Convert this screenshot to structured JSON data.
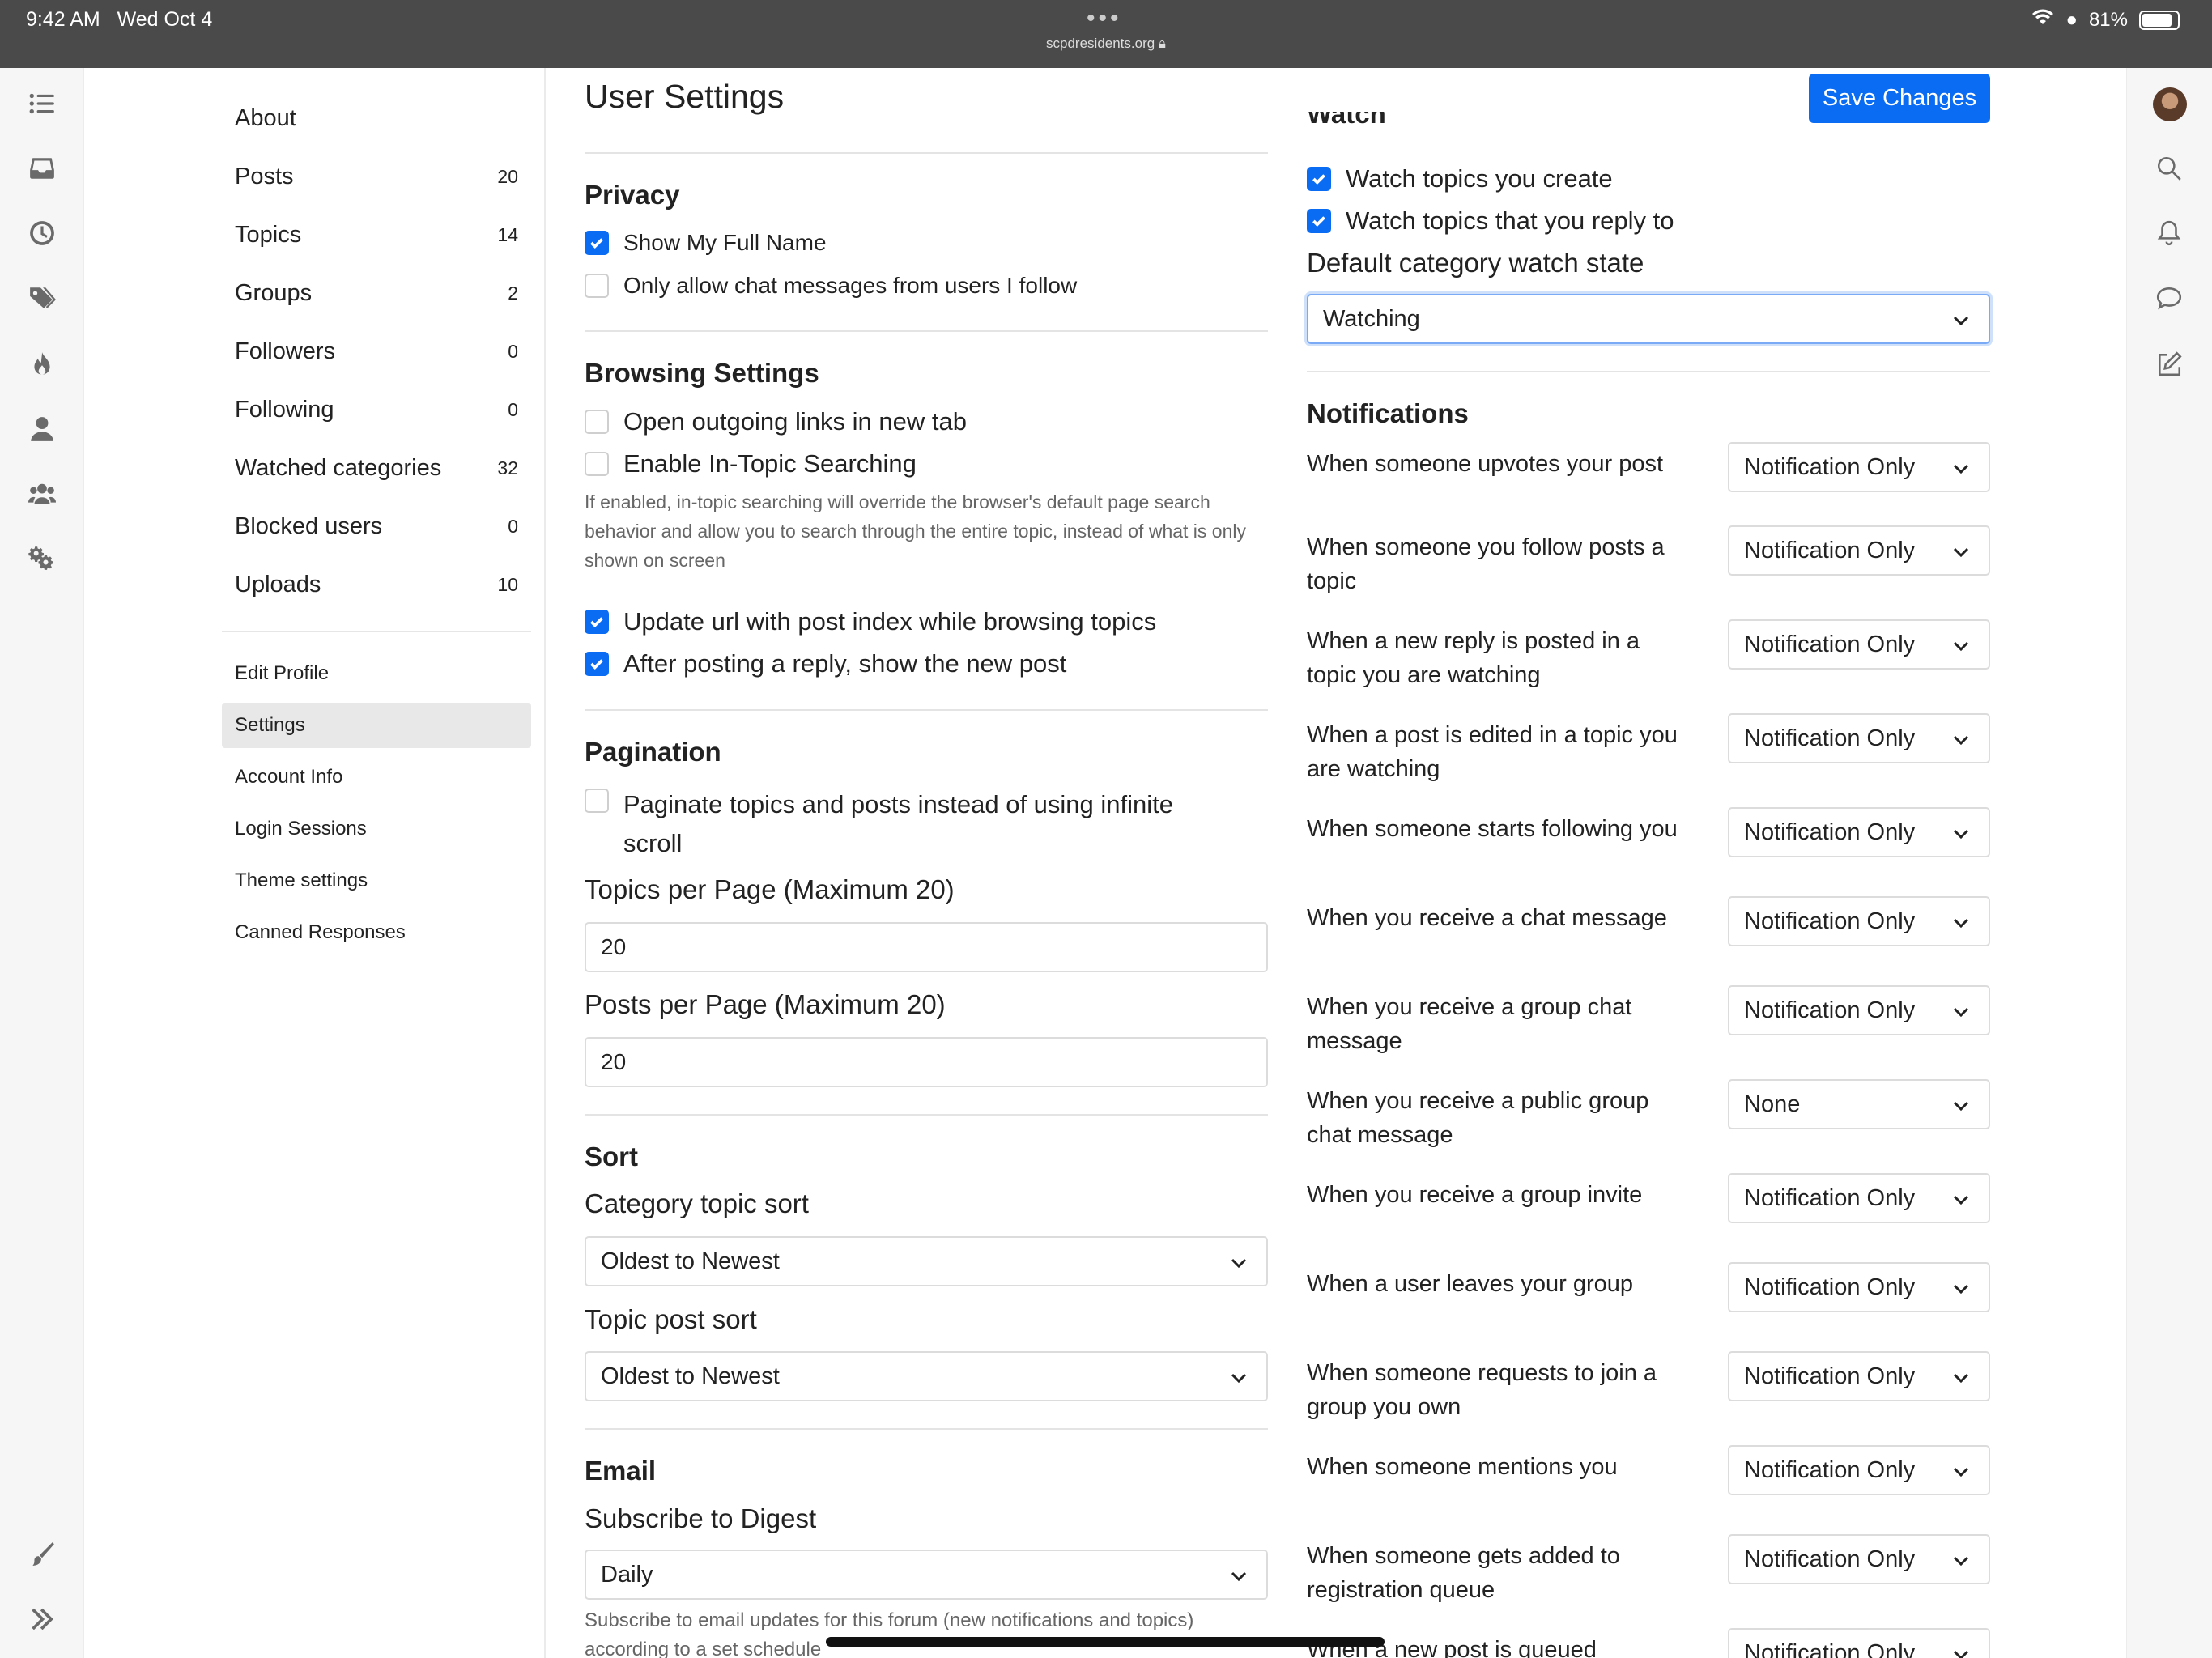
{
  "status": {
    "time": "9:42 AM",
    "date": "Wed Oct 4",
    "url": "scpdresidents.org",
    "battery": "81%"
  },
  "nav": {
    "items": [
      {
        "label": "About",
        "count": ""
      },
      {
        "label": "Posts",
        "count": "20"
      },
      {
        "label": "Topics",
        "count": "14"
      },
      {
        "label": "Groups",
        "count": "2"
      },
      {
        "label": "Followers",
        "count": "0"
      },
      {
        "label": "Following",
        "count": "0"
      },
      {
        "label": "Watched categories",
        "count": "32"
      },
      {
        "label": "Blocked users",
        "count": "0"
      },
      {
        "label": "Uploads",
        "count": "10"
      }
    ],
    "sub": [
      "Edit Profile",
      "Settings",
      "Account Info",
      "Login Sessions",
      "Theme settings",
      "Canned Responses"
    ],
    "active_sub": "Settings"
  },
  "page": {
    "title": "User Settings",
    "save_label": "Save Changes"
  },
  "privacy": {
    "title": "Privacy",
    "show_full_name": {
      "label": "Show My Full Name",
      "checked": true
    },
    "chat_follow_only": {
      "label": "Only allow chat messages from users I follow",
      "checked": false
    }
  },
  "browsing": {
    "title": "Browsing Settings",
    "open_links_new_tab": {
      "label": "Open outgoing links in new tab",
      "checked": false
    },
    "in_topic_search": {
      "label": "Enable In-Topic Searching",
      "checked": false
    },
    "help": "If enabled, in-topic searching will override the browser's default page search behavior and allow you to search through the entire topic, instead of what is only shown on screen",
    "update_url": {
      "label": "Update url with post index while browsing topics",
      "checked": true
    },
    "show_new_post": {
      "label": "After posting a reply, show the new post",
      "checked": true
    }
  },
  "pagination": {
    "title": "Pagination",
    "paginate": {
      "label_line1": "Paginate topics and posts instead of using infinite",
      "label_line2": "scroll",
      "checked": false
    },
    "topics_per_page_label": "Topics per Page (Maximum 20)",
    "topics_per_page": "20",
    "posts_per_page_label": "Posts per Page (Maximum 20)",
    "posts_per_page": "20"
  },
  "sort": {
    "title": "Sort",
    "category_label": "Category topic sort",
    "category_value": "Oldest to Newest",
    "topic_label": "Topic post sort",
    "topic_value": "Oldest to Newest"
  },
  "email": {
    "title": "Email",
    "digest_label": "Subscribe to Digest",
    "digest_value": "Daily",
    "help_line1": "Subscribe to email updates for this forum (new notifications and topics)",
    "help_line2": "according to a set schedule"
  },
  "watch": {
    "title": "Watch",
    "watch_create": {
      "label": "Watch topics you create",
      "checked": true
    },
    "watch_reply": {
      "label": "Watch topics that you reply to",
      "checked": true
    },
    "default_label": "Default category watch state",
    "default_value": "Watching"
  },
  "notifications": {
    "title": "Notifications",
    "rows": [
      {
        "l1": "When someone upvotes your post",
        "l2": "",
        "value": "Notification Only"
      },
      {
        "l1": "When someone you follow posts a",
        "l2": "topic",
        "value": "Notification Only"
      },
      {
        "l1": "When a new reply is posted in a",
        "l2": "topic you are watching",
        "value": "Notification Only"
      },
      {
        "l1": "When a post is edited in a topic you",
        "l2": "are watching",
        "value": "Notification Only"
      },
      {
        "l1": "When someone starts following you",
        "l2": "",
        "value": "Notification Only"
      },
      {
        "l1": "When you receive a chat message",
        "l2": "",
        "value": "Notification Only"
      },
      {
        "l1": "When you receive a group chat",
        "l2": "message",
        "value": "Notification Only"
      },
      {
        "l1": "When you receive a public group",
        "l2": "chat message",
        "value": "None"
      },
      {
        "l1": "When you receive a group invite",
        "l2": "",
        "value": "Notification Only"
      },
      {
        "l1": "When a user leaves your group",
        "l2": "",
        "value": "Notification Only"
      },
      {
        "l1": "When someone requests to join a",
        "l2": "group you own",
        "value": "Notification Only"
      },
      {
        "l1": "When someone mentions you",
        "l2": "",
        "value": "Notification Only"
      },
      {
        "l1": "When someone gets added to",
        "l2": "registration queue",
        "value": "Notification Only"
      },
      {
        "l1": "When a new post is queued",
        "l2": "",
        "value": "Notification Only"
      }
    ]
  },
  "icons": {
    "left_rail": [
      "list-icon",
      "inbox-icon",
      "clock-icon",
      "tags-icon",
      "fire-icon",
      "user-icon",
      "users-icon",
      "gears-icon",
      "brush-icon",
      "expand-icon"
    ],
    "right_rail": [
      "avatar",
      "search-icon",
      "bell-icon",
      "chat-icon",
      "compose-icon"
    ]
  },
  "colors": {
    "accent": "#0a6cf2",
    "statusbar": "#4a4a4a",
    "rail": "#f6f6f6"
  }
}
